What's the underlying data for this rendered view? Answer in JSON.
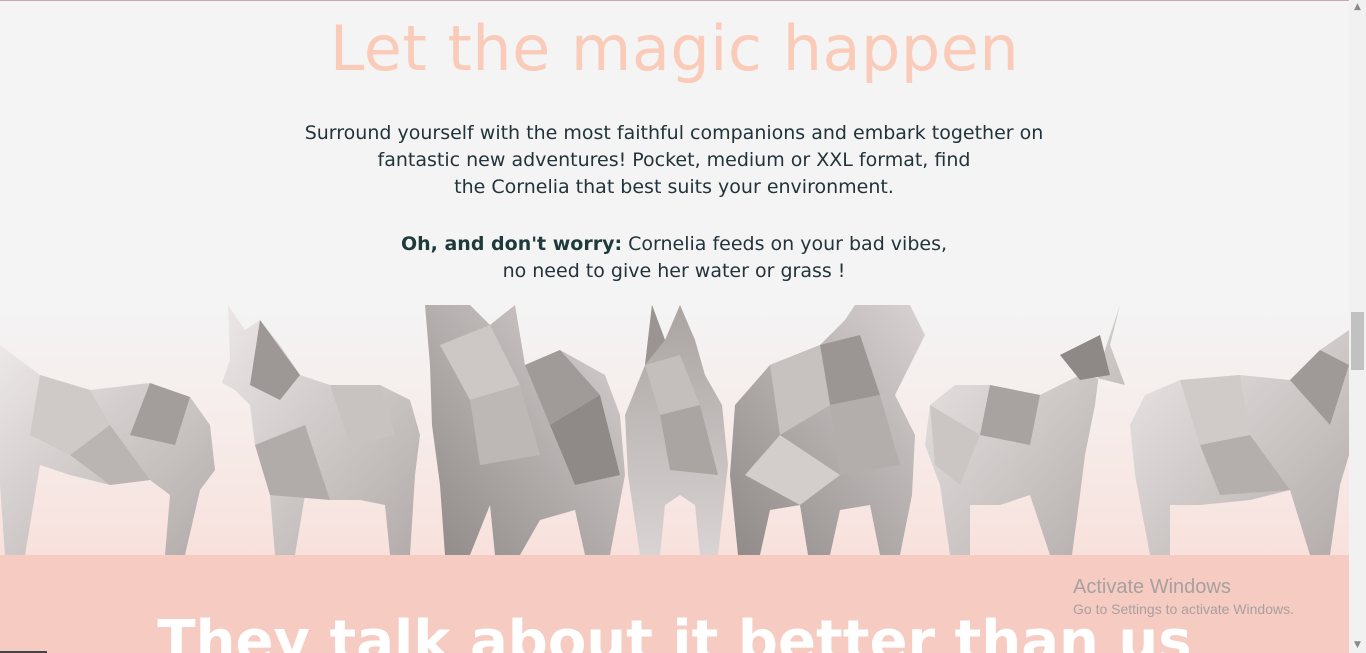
{
  "hero": {
    "title": "Let the magic happen",
    "intro_lines": [
      "Surround yourself with the most faithful companions and embark together on",
      "fantastic new adventures! Pocket, medium or XXL format, find",
      "the Cornelia that best suits your environment."
    ],
    "worry_bold": "Oh, and don't worry:",
    "worry_rest": " Cornelia feeds on your bad vibes,",
    "worry_line2": "no need to give her water or grass !"
  },
  "herd": {
    "image_description_icon": "low-poly-unicorns-icon",
    "colors": {
      "light": "#e8e3e2",
      "mid": "#bcb5b4",
      "dark": "#8e8887"
    }
  },
  "testimonials": {
    "heading": "They talk about it better than us",
    "background": "#f6cbc1"
  },
  "watermark": {
    "title": "Activate Windows",
    "subtitle": "Go to Settings to activate Windows."
  },
  "scrollbar": {
    "up_icon": "▲",
    "down_icon": "▼"
  },
  "colors": {
    "title": "#f9cbb8",
    "text": "#22333b",
    "page_bg": "#f4f4f4"
  }
}
